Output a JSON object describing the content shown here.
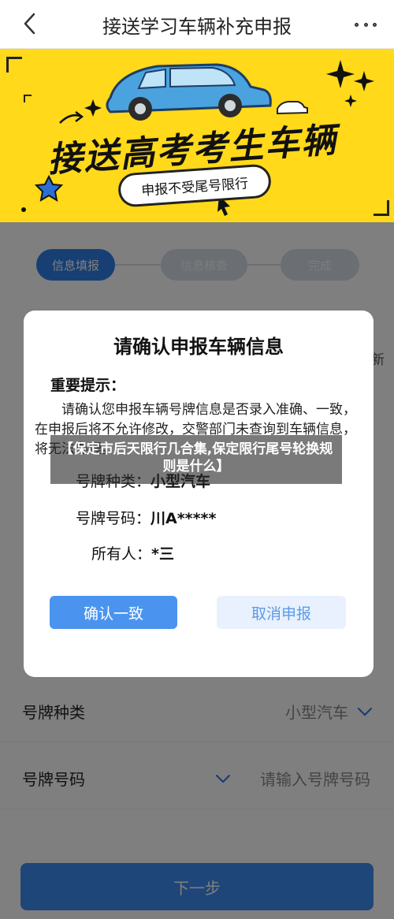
{
  "header": {
    "title": "接送学习车辆补充申报",
    "back_icon": "chevron-left-icon",
    "more_icon": "more-dots-icon"
  },
  "banner": {
    "headline": "接送高考考生车辆",
    "tagline": "申报不受尾号限行",
    "background_color": "#ffd91a"
  },
  "steps": [
    {
      "label": "信息填报",
      "active": true
    },
    {
      "label": "信息核查",
      "active": false
    },
    {
      "label": "完成",
      "active": false
    }
  ],
  "page": {
    "refresh_text": "新",
    "form": {
      "plate_type_label": "号牌种类",
      "plate_type_value": "小型汽车",
      "plate_number_label": "号牌号码",
      "plate_number_placeholder": "请输入号牌号码"
    },
    "next_button": "下一步"
  },
  "modal": {
    "title": "请确认申报车辆信息",
    "notice_head": "重要提示：",
    "notice_body": "请确认您申报车辆号牌信息是否录入准确、一致，在申报后将不允许修改，交警部门未查询到车辆信息，将无法办理。",
    "plate_type_key": "号牌种类：",
    "plate_type_value": "小型汽车",
    "plate_number_key": "号牌号码：",
    "plate_number_value": "川A*****",
    "owner_key": "所有人：",
    "owner_value": "*三",
    "confirm_button": "确认一致",
    "cancel_button": "取消申报"
  },
  "caption": "【保定市后天限行几合集,保定限行尾号轮换规则是什么】",
  "colors": {
    "accent": "#2f7fe6",
    "confirm": "#4a94ef",
    "cancel_bg": "#e8f1fd"
  }
}
